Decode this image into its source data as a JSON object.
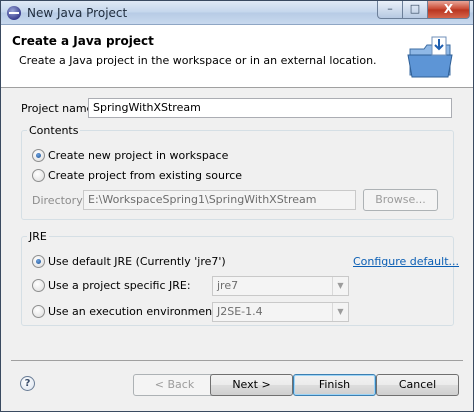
{
  "window": {
    "title": "New Java Project",
    "controls": {
      "minimize": "–",
      "maximize": "□",
      "close": "X"
    }
  },
  "banner": {
    "heading": "Create a Java project",
    "description": "Create a Java project in the workspace or in an external location.",
    "icon": "new-java-project-wizard-icon"
  },
  "project": {
    "name_label": "Project name:",
    "name_value": "SpringWithXStream"
  },
  "contents": {
    "title": "Contents",
    "option_new": "Create new project in workspace",
    "option_existing": "Create project from existing source",
    "selected": "option_new",
    "directory_label": "Directory:",
    "directory_value": "E:\\WorkspaceSpring1\\SpringWithXStream",
    "browse_label": "Browse..."
  },
  "jre": {
    "title": "JRE",
    "option_default": "Use default JRE (Currently 'jre7')",
    "option_specific": "Use a project specific JRE:",
    "option_env": "Use an execution environment JRE:",
    "selected": "option_default",
    "configure_link": "Configure default...",
    "specific_value": "jre7",
    "env_value": "J2SE-1.4"
  },
  "footer": {
    "help_icon": "?",
    "back_label": "< Back",
    "next_label": "Next >",
    "finish_label": "Finish",
    "cancel_label": "Cancel"
  }
}
